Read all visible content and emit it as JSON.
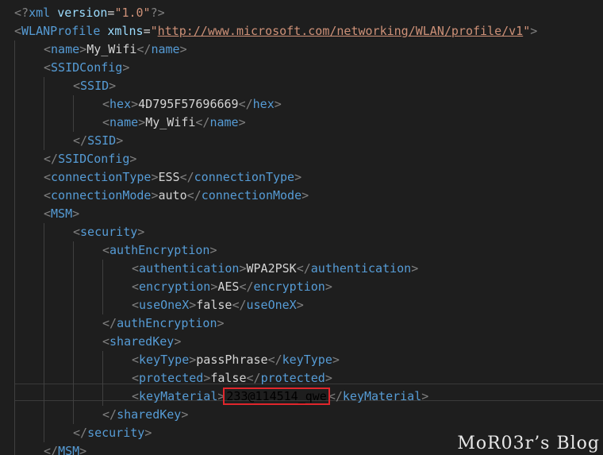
{
  "editor": {
    "lines": [
      {
        "indent": 0,
        "parts": [
          [
            "br",
            "<?"
          ],
          [
            "tag",
            "xml"
          ],
          [
            "txt",
            " "
          ],
          [
            "attr",
            "version"
          ],
          [
            "eq",
            "="
          ],
          [
            "str",
            "\"1.0\""
          ],
          [
            "br",
            "?>"
          ]
        ]
      },
      {
        "indent": 0,
        "parts": [
          [
            "br",
            "<"
          ],
          [
            "tag",
            "WLANProfile"
          ],
          [
            "txt",
            " "
          ],
          [
            "attr",
            "xmlns"
          ],
          [
            "eq",
            "="
          ],
          [
            "str",
            "\""
          ],
          [
            "link",
            "http://www.microsoft.com/networking/WLAN/profile/v1"
          ],
          [
            "str",
            "\""
          ],
          [
            "br",
            ">"
          ]
        ]
      },
      {
        "indent": 1,
        "parts": [
          [
            "br",
            "<"
          ],
          [
            "tag",
            "name"
          ],
          [
            "br",
            ">"
          ],
          [
            "txt",
            "My_Wifi"
          ],
          [
            "br",
            "</"
          ],
          [
            "tag",
            "name"
          ],
          [
            "br",
            ">"
          ]
        ]
      },
      {
        "indent": 1,
        "parts": [
          [
            "br",
            "<"
          ],
          [
            "tag",
            "SSIDConfig"
          ],
          [
            "br",
            ">"
          ]
        ]
      },
      {
        "indent": 2,
        "parts": [
          [
            "br",
            "<"
          ],
          [
            "tag",
            "SSID"
          ],
          [
            "br",
            ">"
          ]
        ]
      },
      {
        "indent": 3,
        "parts": [
          [
            "br",
            "<"
          ],
          [
            "tag",
            "hex"
          ],
          [
            "br",
            ">"
          ],
          [
            "txt",
            "4D795F57696669"
          ],
          [
            "br",
            "</"
          ],
          [
            "tag",
            "hex"
          ],
          [
            "br",
            ">"
          ]
        ]
      },
      {
        "indent": 3,
        "parts": [
          [
            "br",
            "<"
          ],
          [
            "tag",
            "name"
          ],
          [
            "br",
            ">"
          ],
          [
            "txt",
            "My_Wifi"
          ],
          [
            "br",
            "</"
          ],
          [
            "tag",
            "name"
          ],
          [
            "br",
            ">"
          ]
        ]
      },
      {
        "indent": 2,
        "parts": [
          [
            "br",
            "</"
          ],
          [
            "tag",
            "SSID"
          ],
          [
            "br",
            ">"
          ]
        ]
      },
      {
        "indent": 1,
        "parts": [
          [
            "br",
            "</"
          ],
          [
            "tag",
            "SSIDConfig"
          ],
          [
            "br",
            ">"
          ]
        ]
      },
      {
        "indent": 1,
        "parts": [
          [
            "br",
            "<"
          ],
          [
            "tag",
            "connectionType"
          ],
          [
            "br",
            ">"
          ],
          [
            "txt",
            "ESS"
          ],
          [
            "br",
            "</"
          ],
          [
            "tag",
            "connectionType"
          ],
          [
            "br",
            ">"
          ]
        ]
      },
      {
        "indent": 1,
        "parts": [
          [
            "br",
            "<"
          ],
          [
            "tag",
            "connectionMode"
          ],
          [
            "br",
            ">"
          ],
          [
            "txt",
            "auto"
          ],
          [
            "br",
            "</"
          ],
          [
            "tag",
            "connectionMode"
          ],
          [
            "br",
            ">"
          ]
        ]
      },
      {
        "indent": 1,
        "parts": [
          [
            "br",
            "<"
          ],
          [
            "tag",
            "MSM"
          ],
          [
            "br",
            ">"
          ]
        ]
      },
      {
        "indent": 2,
        "parts": [
          [
            "br",
            "<"
          ],
          [
            "tag",
            "security"
          ],
          [
            "br",
            ">"
          ]
        ]
      },
      {
        "indent": 3,
        "parts": [
          [
            "br",
            "<"
          ],
          [
            "tag",
            "authEncryption"
          ],
          [
            "br",
            ">"
          ]
        ]
      },
      {
        "indent": 4,
        "parts": [
          [
            "br",
            "<"
          ],
          [
            "tag",
            "authentication"
          ],
          [
            "br",
            ">"
          ],
          [
            "txt",
            "WPA2PSK"
          ],
          [
            "br",
            "</"
          ],
          [
            "tag",
            "authentication"
          ],
          [
            "br",
            ">"
          ]
        ]
      },
      {
        "indent": 4,
        "parts": [
          [
            "br",
            "<"
          ],
          [
            "tag",
            "encryption"
          ],
          [
            "br",
            ">"
          ],
          [
            "txt",
            "AES"
          ],
          [
            "br",
            "</"
          ],
          [
            "tag",
            "encryption"
          ],
          [
            "br",
            ">"
          ]
        ]
      },
      {
        "indent": 4,
        "parts": [
          [
            "br",
            "<"
          ],
          [
            "tag",
            "useOneX"
          ],
          [
            "br",
            ">"
          ],
          [
            "txt",
            "false"
          ],
          [
            "br",
            "</"
          ],
          [
            "tag",
            "useOneX"
          ],
          [
            "br",
            ">"
          ]
        ]
      },
      {
        "indent": 3,
        "parts": [
          [
            "br",
            "</"
          ],
          [
            "tag",
            "authEncryption"
          ],
          [
            "br",
            ">"
          ]
        ]
      },
      {
        "indent": 3,
        "parts": [
          [
            "br",
            "<"
          ],
          [
            "tag",
            "sharedKey"
          ],
          [
            "br",
            ">"
          ]
        ]
      },
      {
        "indent": 4,
        "parts": [
          [
            "br",
            "<"
          ],
          [
            "tag",
            "keyType"
          ],
          [
            "br",
            ">"
          ],
          [
            "txt",
            "passPhrase"
          ],
          [
            "br",
            "</"
          ],
          [
            "tag",
            "keyType"
          ],
          [
            "br",
            ">"
          ]
        ]
      },
      {
        "indent": 4,
        "parts": [
          [
            "br",
            "<"
          ],
          [
            "tag",
            "protected"
          ],
          [
            "br",
            ">"
          ],
          [
            "txt",
            "false"
          ],
          [
            "br",
            "</"
          ],
          [
            "tag",
            "protected"
          ],
          [
            "br",
            ">"
          ]
        ]
      },
      {
        "indent": 4,
        "parts": [
          [
            "br",
            "<"
          ],
          [
            "tag",
            "keyMaterial"
          ],
          [
            "br",
            ">"
          ],
          [
            "hl",
            "233@114514_qwe"
          ],
          [
            "br",
            "</"
          ],
          [
            "tag",
            "keyMaterial"
          ],
          [
            "br",
            ">"
          ]
        ]
      },
      {
        "indent": 3,
        "parts": [
          [
            "br",
            "</"
          ],
          [
            "tag",
            "sharedKey"
          ],
          [
            "br",
            ">"
          ]
        ]
      },
      {
        "indent": 2,
        "parts": [
          [
            "br",
            "</"
          ],
          [
            "tag",
            "security"
          ],
          [
            "br",
            ">"
          ]
        ]
      },
      {
        "indent": 1,
        "parts": [
          [
            "br",
            "</"
          ],
          [
            "tag",
            "MSM"
          ],
          [
            "br",
            ">"
          ]
        ]
      }
    ],
    "highlighted_value": "233@114514_qwe"
  },
  "watermark": "MoR03r’s Blog",
  "colors": {
    "background": "#1e1e1e",
    "tag": "#569cd6",
    "attribute": "#9cdcfe",
    "string": "#ce9178",
    "bracket": "#808080",
    "text": "#d4d4d4",
    "highlight_box": "#e0262c"
  }
}
